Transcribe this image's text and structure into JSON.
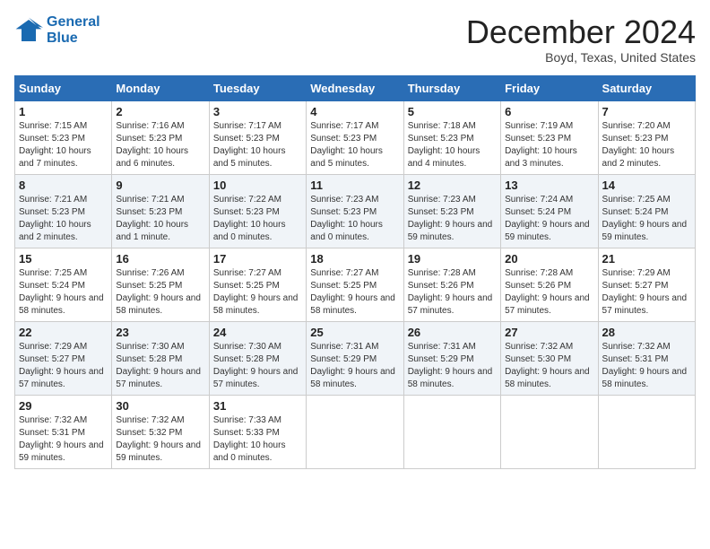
{
  "header": {
    "logo_line1": "General",
    "logo_line2": "Blue",
    "month": "December 2024",
    "location": "Boyd, Texas, United States"
  },
  "weekdays": [
    "Sunday",
    "Monday",
    "Tuesday",
    "Wednesday",
    "Thursday",
    "Friday",
    "Saturday"
  ],
  "weeks": [
    [
      {
        "day": "1",
        "sunrise": "7:15 AM",
        "sunset": "5:23 PM",
        "daylight": "10 hours and 7 minutes."
      },
      {
        "day": "2",
        "sunrise": "7:16 AM",
        "sunset": "5:23 PM",
        "daylight": "10 hours and 6 minutes."
      },
      {
        "day": "3",
        "sunrise": "7:17 AM",
        "sunset": "5:23 PM",
        "daylight": "10 hours and 5 minutes."
      },
      {
        "day": "4",
        "sunrise": "7:17 AM",
        "sunset": "5:23 PM",
        "daylight": "10 hours and 5 minutes."
      },
      {
        "day": "5",
        "sunrise": "7:18 AM",
        "sunset": "5:23 PM",
        "daylight": "10 hours and 4 minutes."
      },
      {
        "day": "6",
        "sunrise": "7:19 AM",
        "sunset": "5:23 PM",
        "daylight": "10 hours and 3 minutes."
      },
      {
        "day": "7",
        "sunrise": "7:20 AM",
        "sunset": "5:23 PM",
        "daylight": "10 hours and 2 minutes."
      }
    ],
    [
      {
        "day": "8",
        "sunrise": "7:21 AM",
        "sunset": "5:23 PM",
        "daylight": "10 hours and 2 minutes."
      },
      {
        "day": "9",
        "sunrise": "7:21 AM",
        "sunset": "5:23 PM",
        "daylight": "10 hours and 1 minute."
      },
      {
        "day": "10",
        "sunrise": "7:22 AM",
        "sunset": "5:23 PM",
        "daylight": "10 hours and 0 minutes."
      },
      {
        "day": "11",
        "sunrise": "7:23 AM",
        "sunset": "5:23 PM",
        "daylight": "10 hours and 0 minutes."
      },
      {
        "day": "12",
        "sunrise": "7:23 AM",
        "sunset": "5:23 PM",
        "daylight": "9 hours and 59 minutes."
      },
      {
        "day": "13",
        "sunrise": "7:24 AM",
        "sunset": "5:24 PM",
        "daylight": "9 hours and 59 minutes."
      },
      {
        "day": "14",
        "sunrise": "7:25 AM",
        "sunset": "5:24 PM",
        "daylight": "9 hours and 59 minutes."
      }
    ],
    [
      {
        "day": "15",
        "sunrise": "7:25 AM",
        "sunset": "5:24 PM",
        "daylight": "9 hours and 58 minutes."
      },
      {
        "day": "16",
        "sunrise": "7:26 AM",
        "sunset": "5:25 PM",
        "daylight": "9 hours and 58 minutes."
      },
      {
        "day": "17",
        "sunrise": "7:27 AM",
        "sunset": "5:25 PM",
        "daylight": "9 hours and 58 minutes."
      },
      {
        "day": "18",
        "sunrise": "7:27 AM",
        "sunset": "5:25 PM",
        "daylight": "9 hours and 58 minutes."
      },
      {
        "day": "19",
        "sunrise": "7:28 AM",
        "sunset": "5:26 PM",
        "daylight": "9 hours and 57 minutes."
      },
      {
        "day": "20",
        "sunrise": "7:28 AM",
        "sunset": "5:26 PM",
        "daylight": "9 hours and 57 minutes."
      },
      {
        "day": "21",
        "sunrise": "7:29 AM",
        "sunset": "5:27 PM",
        "daylight": "9 hours and 57 minutes."
      }
    ],
    [
      {
        "day": "22",
        "sunrise": "7:29 AM",
        "sunset": "5:27 PM",
        "daylight": "9 hours and 57 minutes."
      },
      {
        "day": "23",
        "sunrise": "7:30 AM",
        "sunset": "5:28 PM",
        "daylight": "9 hours and 57 minutes."
      },
      {
        "day": "24",
        "sunrise": "7:30 AM",
        "sunset": "5:28 PM",
        "daylight": "9 hours and 57 minutes."
      },
      {
        "day": "25",
        "sunrise": "7:31 AM",
        "sunset": "5:29 PM",
        "daylight": "9 hours and 58 minutes."
      },
      {
        "day": "26",
        "sunrise": "7:31 AM",
        "sunset": "5:29 PM",
        "daylight": "9 hours and 58 minutes."
      },
      {
        "day": "27",
        "sunrise": "7:32 AM",
        "sunset": "5:30 PM",
        "daylight": "9 hours and 58 minutes."
      },
      {
        "day": "28",
        "sunrise": "7:32 AM",
        "sunset": "5:31 PM",
        "daylight": "9 hours and 58 minutes."
      }
    ],
    [
      {
        "day": "29",
        "sunrise": "7:32 AM",
        "sunset": "5:31 PM",
        "daylight": "9 hours and 59 minutes."
      },
      {
        "day": "30",
        "sunrise": "7:32 AM",
        "sunset": "5:32 PM",
        "daylight": "9 hours and 59 minutes."
      },
      {
        "day": "31",
        "sunrise": "7:33 AM",
        "sunset": "5:33 PM",
        "daylight": "10 hours and 0 minutes."
      },
      null,
      null,
      null,
      null
    ]
  ]
}
